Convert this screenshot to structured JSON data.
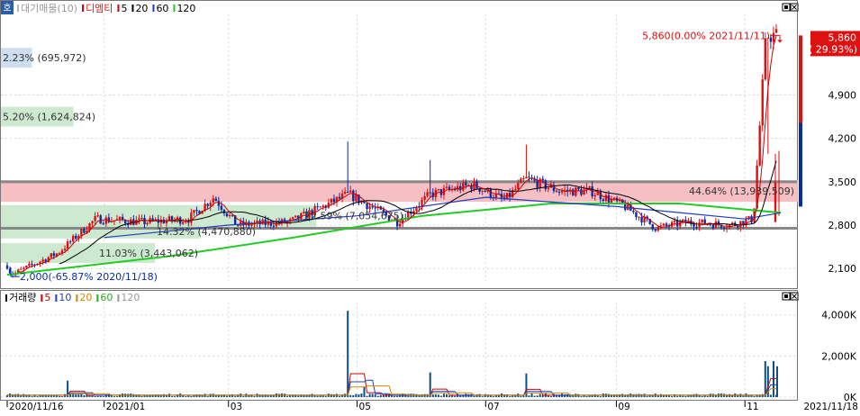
{
  "header": {
    "corner_icon": "home-icon",
    "corner_label": "호",
    "price_legend": [
      {
        "label": "대기매물(10)",
        "color": "#b8b8b8"
      },
      {
        "label": "디엠티",
        "color": "#cc0000"
      },
      {
        "label": "5",
        "color": "#cc0000"
      },
      {
        "label": "20",
        "color": "#000000"
      },
      {
        "label": "60",
        "color": "#1f3fbf"
      },
      {
        "label": "120",
        "color": "#22cc22"
      }
    ],
    "volume_legend": [
      {
        "label": "거래량",
        "color": "#000000"
      },
      {
        "label": "5",
        "color": "#cc0000"
      },
      {
        "label": "10",
        "color": "#1f3fbf"
      },
      {
        "label": "20",
        "color": "#cc8800"
      },
      {
        "label": "60",
        "color": "#22aa22"
      },
      {
        "label": "120",
        "color": "#999999"
      }
    ]
  },
  "window_buttons": {
    "restore_icon": "restore-icon",
    "close_icon": "close-icon"
  },
  "colors": {
    "up": "#dd1111",
    "down": "#0a2ca8",
    "ma5": "#cc0000",
    "ma20": "#000000",
    "ma60": "#1f3fbf",
    "ma120": "#22cc22",
    "volume": "#0d4f86",
    "grid": "#d8d8d8",
    "resistance_band": "#f4b8bc",
    "support_band": "#c8e8cc",
    "hline": "#888888",
    "price_tag_bg": "#dd1111"
  },
  "annotations": {
    "high": "5,860(0.00% 2021/11/11)",
    "low": "2,000(-65.87% 2020/11/18)",
    "current_price": "5,860",
    "current_change": "( 29.93%)"
  },
  "chart_data": [
    {
      "type": "candlestick",
      "title": "디엠티",
      "x_ticks": [
        "2020/11/16",
        "2021/01",
        "03",
        "05",
        "07",
        "09",
        "11",
        "2021/11/18"
      ],
      "y_ticks": [
        2100,
        2800,
        3500,
        4200,
        4900
      ],
      "ylim": [
        1900,
        6200
      ],
      "grid": true,
      "volume_profile": [
        {
          "label": "2.23% (695,972)",
          "price": 5500,
          "pct": 2.23
        },
        {
          "label": "5.20% (1,624,824)",
          "price": 4550,
          "pct": 5.2
        },
        {
          "label": "44.64% (13,939,509)",
          "price": 3350,
          "pct": 44.64
        },
        {
          "label": "22.59% (7,054,675)",
          "price": 2950,
          "pct": 22.59
        },
        {
          "label": "14.32% (4,470,880)",
          "price": 2700,
          "pct": 14.32
        },
        {
          "label": "11.03% (3,443,062)",
          "price": 2350,
          "pct": 11.03
        }
      ],
      "horizontal_lines": [
        3500,
        2750
      ],
      "price_path": [
        {
          "date": "2020/11/16",
          "close": 2150
        },
        {
          "date": "2020/11/18",
          "close": 2000
        },
        {
          "date": "2020/12/10",
          "close": 2350
        },
        {
          "date": "2020/12/28",
          "close": 2900
        },
        {
          "date": "2021/01/20",
          "close": 2850
        },
        {
          "date": "2021/02/10",
          "close": 2900
        },
        {
          "date": "2021/02/22",
          "close": 3250
        },
        {
          "date": "2021/03/05",
          "close": 2800
        },
        {
          "date": "2021/03/30",
          "close": 2850
        },
        {
          "date": "2021/04/15",
          "close": 3100
        },
        {
          "date": "2021/04/27",
          "close": 3300
        },
        {
          "date": "2021/05/10",
          "close": 3050
        },
        {
          "date": "2021/05/20",
          "close": 2850
        },
        {
          "date": "2021/06/05",
          "close": 3300
        },
        {
          "date": "2021/06/25",
          "close": 3450
        },
        {
          "date": "2021/07/10",
          "close": 3200
        },
        {
          "date": "2021/07/20",
          "close": 3550
        },
        {
          "date": "2021/08/05",
          "close": 3350
        },
        {
          "date": "2021/08/20",
          "close": 3350
        },
        {
          "date": "2021/09/05",
          "close": 3100
        },
        {
          "date": "2021/09/20",
          "close": 2750
        },
        {
          "date": "2021/10/05",
          "close": 2850
        },
        {
          "date": "2021/10/25",
          "close": 2800
        },
        {
          "date": "2021/11/05",
          "close": 2900
        },
        {
          "date": "2021/11/11",
          "close": 5860
        },
        {
          "date": "2021/11/18",
          "close": 5860
        }
      ],
      "spikes": [
        {
          "date": "2021/04/27",
          "high": 4150
        },
        {
          "date": "2021/06/05",
          "high": 3850
        },
        {
          "date": "2021/07/20",
          "high": 4100
        },
        {
          "date": "2021/11/12",
          "high": 3950
        }
      ],
      "ma120": [
        {
          "date": "2020/11/16",
          "value": 2000
        },
        {
          "date": "2021/02/01",
          "value": 2300
        },
        {
          "date": "2021/04/01",
          "value": 2600
        },
        {
          "date": "2021/06/01",
          "value": 2950
        },
        {
          "date": "2021/08/01",
          "value": 3150
        },
        {
          "date": "2021/10/01",
          "value": 3150
        },
        {
          "date": "2021/11/18",
          "value": 3000
        }
      ],
      "ma60": [
        {
          "date": "2021/01/01",
          "value": 2600
        },
        {
          "date": "2021/03/01",
          "value": 2800
        },
        {
          "date": "2021/05/01",
          "value": 2950
        },
        {
          "date": "2021/07/01",
          "value": 3250
        },
        {
          "date": "2021/09/01",
          "value": 3100
        },
        {
          "date": "2021/11/01",
          "value": 2900
        },
        {
          "date": "2021/11/18",
          "value": 3000
        }
      ]
    },
    {
      "type": "bar",
      "title": "거래량",
      "y_ticks": [
        "4,000K",
        "2,000K",
        "0K"
      ],
      "y_values": [
        4000000,
        2000000,
        0
      ],
      "ylim": [
        0,
        4600000
      ],
      "spikes": [
        {
          "date": "2020/12/15",
          "value": 800000
        },
        {
          "date": "2021/04/27",
          "value": 4200000
        },
        {
          "date": "2021/05/05",
          "value": 500000
        },
        {
          "date": "2021/06/05",
          "value": 1200000
        },
        {
          "date": "2021/07/20",
          "value": 1150000
        },
        {
          "date": "2021/11/11",
          "value": 1750000
        },
        {
          "date": "2021/11/12",
          "value": 1500000
        }
      ]
    }
  ]
}
